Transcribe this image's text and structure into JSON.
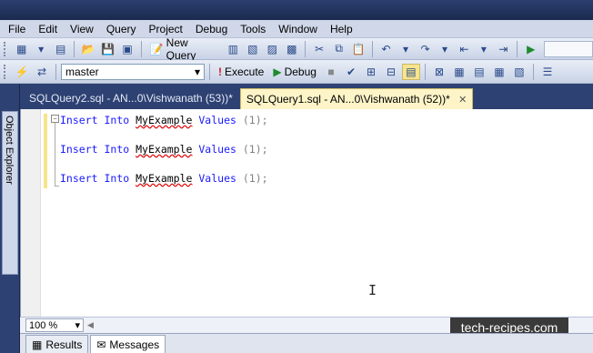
{
  "menu": [
    "File",
    "Edit",
    "View",
    "Query",
    "Project",
    "Debug",
    "Tools",
    "Window",
    "Help"
  ],
  "toolbar1": {
    "new_query_label": "New Query"
  },
  "toolbar2": {
    "database": "master",
    "execute_label": "Execute",
    "debug_label": "Debug"
  },
  "sidebar": {
    "object_explorer_label": "Object Explorer"
  },
  "tabs": [
    {
      "label": "SQLQuery2.sql - AN...0\\Vishwanath (53))*",
      "active": false
    },
    {
      "label": "SQLQuery1.sql - AN...0\\Vishwanath (52))*",
      "active": true
    }
  ],
  "editor": {
    "lines": [
      {
        "kw1": "Insert",
        "kw2": "Into",
        "table": "MyExample",
        "kw3": "Values",
        "args": "(1);"
      },
      {
        "kw1": "Insert",
        "kw2": "Into",
        "table": "MyExample",
        "kw3": "Values",
        "args": "(1);"
      },
      {
        "kw1": "Insert",
        "kw2": "Into",
        "table": "MyExample",
        "kw3": "Values",
        "args": "(1);"
      }
    ]
  },
  "status": {
    "zoom": "100 %"
  },
  "results_tabs": {
    "results_label": "Results",
    "messages_label": "Messages"
  },
  "watermark": "tech-recipes.com",
  "colors": {
    "keyword": "#1a1aff",
    "tab_active_bg": "#fdf4c8",
    "chrome_dark": "#2d4172"
  }
}
